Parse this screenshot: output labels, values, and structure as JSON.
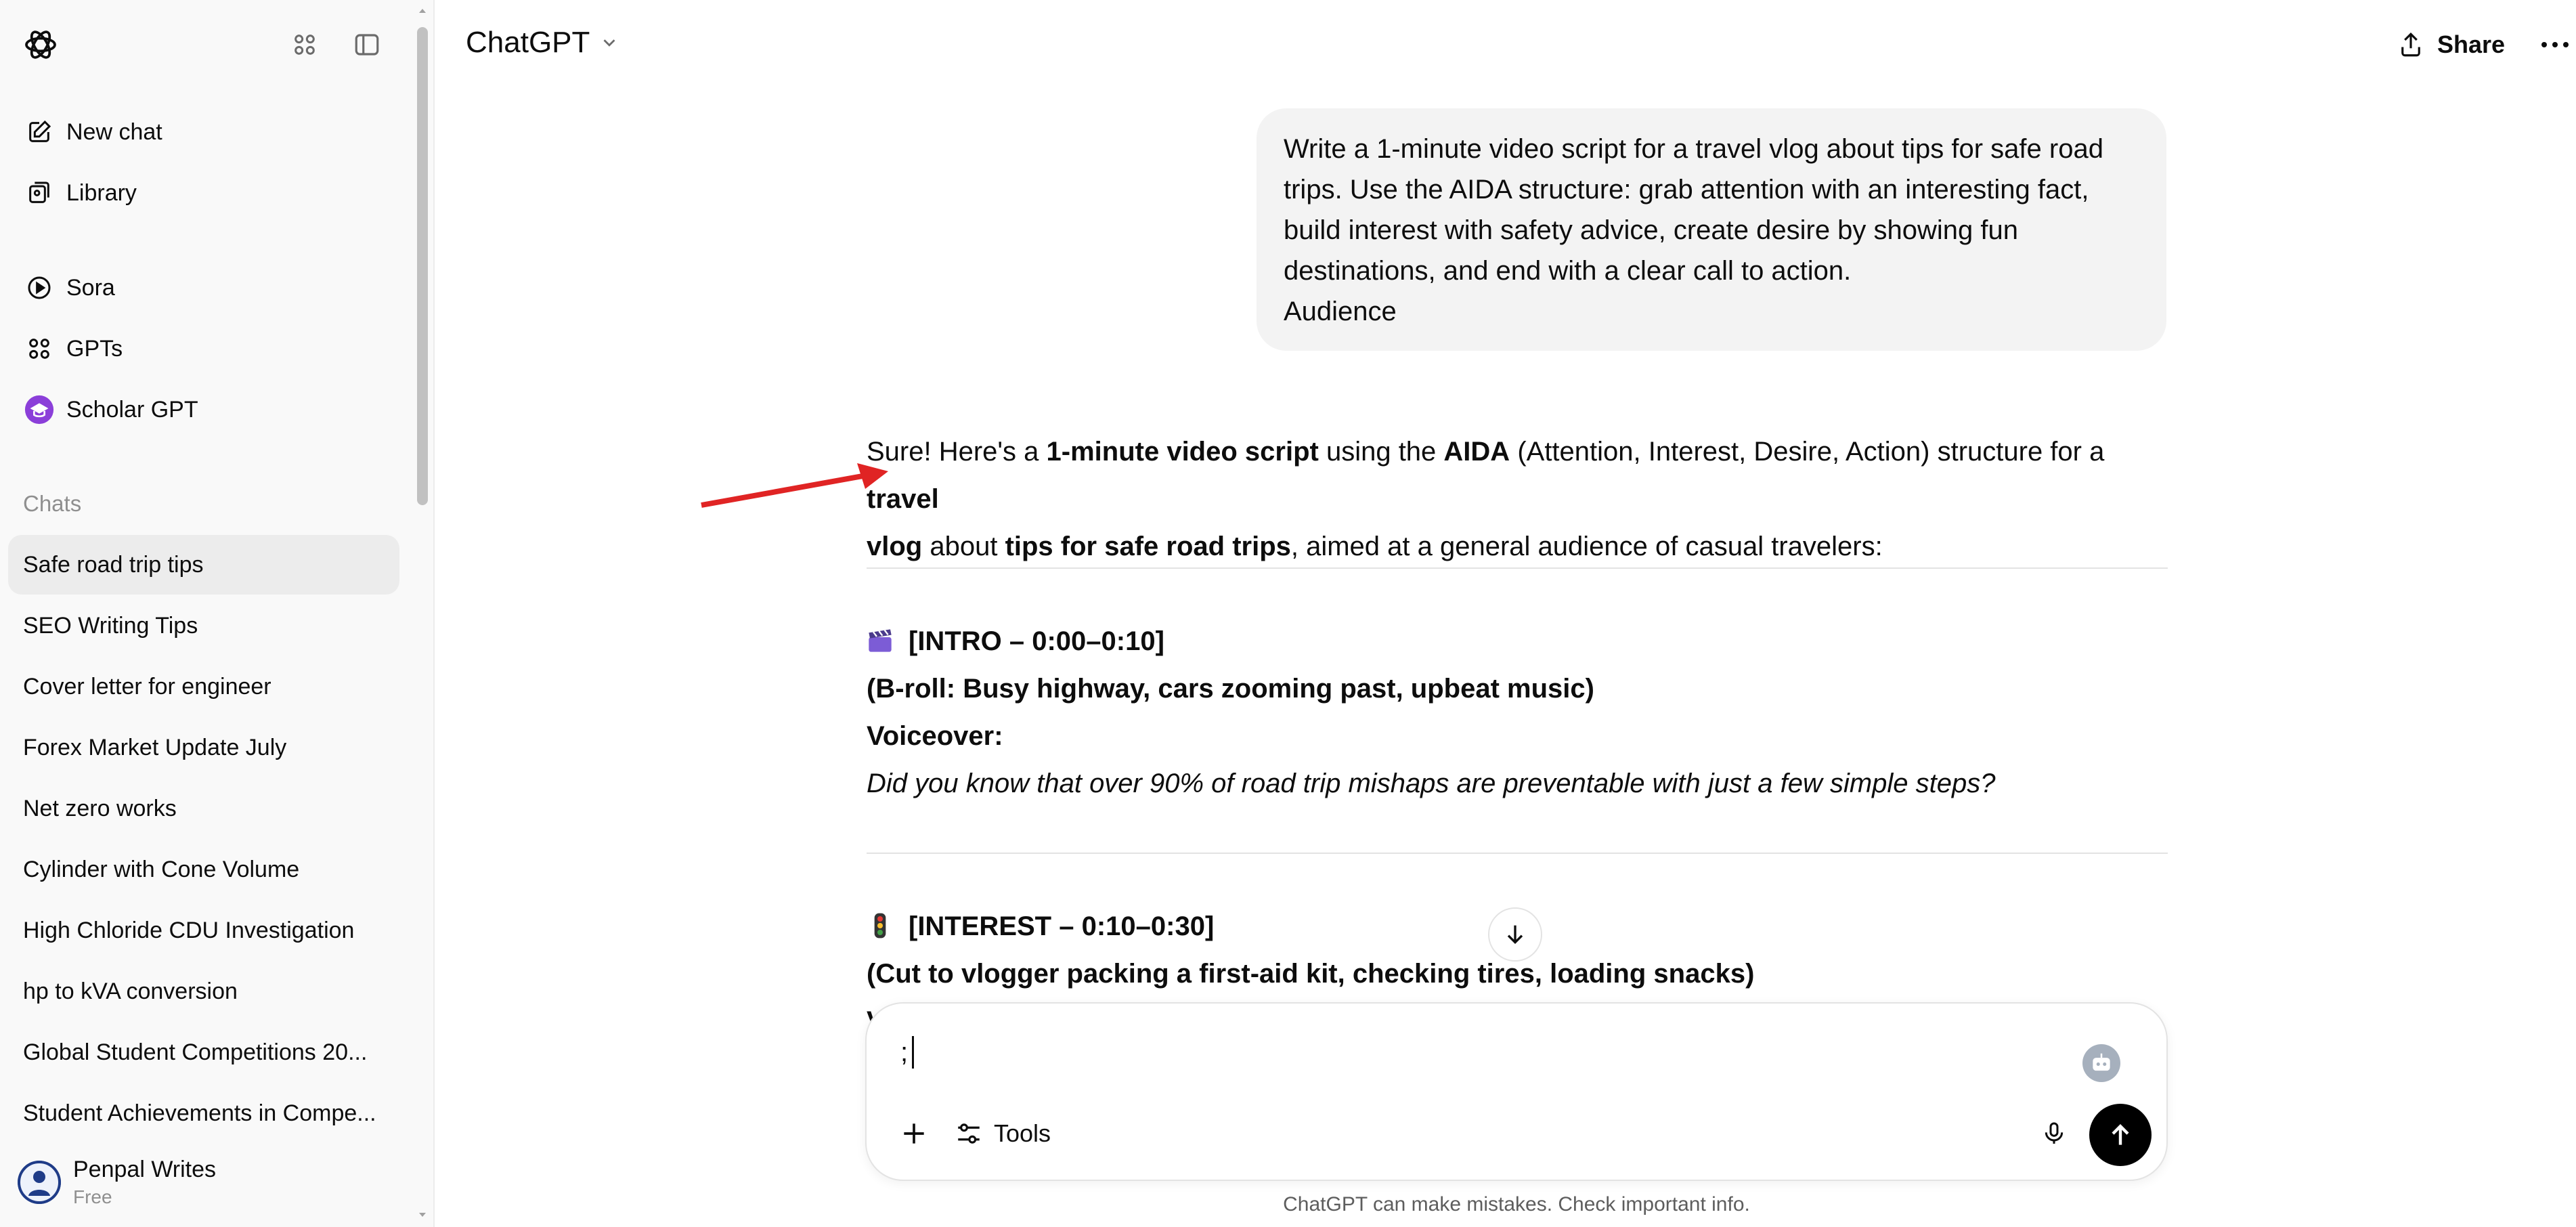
{
  "sidebar": {
    "nav": [
      {
        "label": "New chat",
        "icon": "edit-icon"
      },
      {
        "label": "Library",
        "icon": "library-icon"
      },
      {
        "label": "Sora",
        "icon": "play-circle-icon"
      },
      {
        "label": "GPTs",
        "icon": "grid-icon"
      },
      {
        "label": "Scholar GPT",
        "icon": "scholar-gpt-icon"
      }
    ],
    "chats_title": "Chats",
    "chats": [
      "Safe road trip tips",
      "SEO Writing Tips",
      "Cover letter for engineer",
      "Forex Market Update July",
      "Net zero works",
      "Cylinder with Cone Volume",
      "High Chloride CDU Investigation",
      "hp to kVA conversion",
      "Global Student Competitions 20...",
      "Student Achievements in Compe..."
    ],
    "user": {
      "name": "Penpal Writes",
      "plan": "Free"
    }
  },
  "header": {
    "model": "ChatGPT",
    "share": "Share"
  },
  "conversation": {
    "user_message": [
      "Write a 1-minute video script for a travel vlog about tips for safe road",
      "trips. Use the AIDA structure: grab attention with an interesting fact,",
      "build interest with safety advice, create desire by showing fun",
      "destinations, and end with a clear call to action.",
      "Audience"
    ],
    "response_intro": {
      "p1": "Sure! Here's a ",
      "b1": "1-minute video script",
      "p2": " using the ",
      "b2": "AIDA",
      "p3": " (Attention, Interest, Desire, Action) structure for a ",
      "b3": "travel",
      "b3b": "vlog",
      "p4": " about ",
      "b4": "tips for safe road trips",
      "p5": ", aimed at a general audience of casual travelers:"
    },
    "intro_section": {
      "heading": "[INTRO – 0:00–0:10]",
      "broll": "(B-roll: Busy highway, cars zooming past, upbeat music)",
      "voiceover_label": "Voiceover:",
      "voiceover_text": "Did you know that over 90% of road trip mishaps are preventable with just a few simple steps?"
    },
    "interest_section": {
      "heading": "[INTEREST – 0:10–0:30]",
      "broll": "(Cut to vlogger packing a first-aid kit, checking tires, loading snacks)",
      "next_line_fragment": "V"
    }
  },
  "composer": {
    "value": ";",
    "tools": "Tools"
  },
  "disclaimer": "ChatGPT can make mistakes. Check important info.",
  "colors": {
    "accent_red_arrow": "#e02424",
    "send_button": "#000000",
    "sidebar_bg": "#f9f9f9",
    "bubble_bg": "#f3f3f3"
  }
}
